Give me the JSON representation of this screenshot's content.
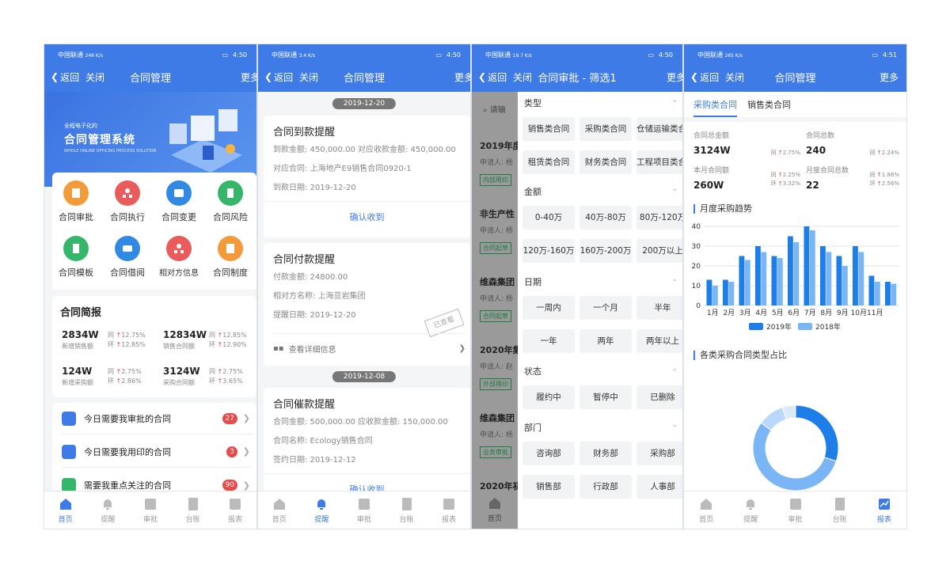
{
  "colors": {
    "primary": "#3f7be6",
    "series2019": "#1e7ee8",
    "series2018": "#7ab6f5",
    "danger": "#e84a4a"
  },
  "status_bars": [
    {
      "carrier": "中国联通",
      "speed": "246 K/s",
      "time": "4:50"
    },
    {
      "carrier": "中国联通",
      "speed": "3.4 K/s",
      "time": "4:50"
    },
    {
      "carrier": "中国联通",
      "speed": "19.7 K/s",
      "time": "4:50"
    },
    {
      "carrier": "中国联通",
      "speed": "265 K/s",
      "time": "4:51"
    }
  ],
  "nav": {
    "back": "返回",
    "close": "关闭",
    "more": "更多"
  },
  "screen1": {
    "title": "合同管理",
    "banner_small": "全程电子化的",
    "banner_title": "合同管理系统",
    "banner_en": "WHOLE ONLINE OFFICING PROCESS SOLUTION",
    "grid": [
      {
        "label": "合同审批",
        "color": "#f39a3a",
        "icon": "approval-icon"
      },
      {
        "label": "合同执行",
        "color": "#ea5b5b",
        "icon": "org-icon"
      },
      {
        "label": "合同变更",
        "color": "#3189e3",
        "icon": "change-icon"
      },
      {
        "label": "合同风险",
        "color": "#36b66a",
        "icon": "risk-icon"
      },
      {
        "label": "合同模板",
        "color": "#36b66a",
        "icon": "template-icon"
      },
      {
        "label": "合同借阅",
        "color": "#3189e3",
        "icon": "borrow-icon"
      },
      {
        "label": "相对方信息",
        "color": "#ea5b5b",
        "icon": "counterparty-icon"
      },
      {
        "label": "合同制度",
        "color": "#f39a3a",
        "icon": "policy-icon"
      }
    ],
    "brief_title": "合同简报",
    "metrics": [
      {
        "value": "2834W",
        "label": "新增销售额",
        "c1": "同",
        "p1": "12.75%",
        "c2": "环",
        "p2": "12.85%"
      },
      {
        "value": "12834W",
        "label": "销售合同额",
        "c1": "同",
        "p1": "12.85%",
        "c2": "环",
        "p2": "12.90%"
      },
      {
        "value": "124W",
        "label": "新增采购额",
        "c1": "同",
        "p1": "2.75%",
        "c2": "环",
        "p2": "2.86%"
      },
      {
        "value": "3124W",
        "label": "采购合同额",
        "c1": "同",
        "p1": "2.75%",
        "c2": "环",
        "p2": "3.65%"
      }
    ],
    "todos": [
      {
        "label": "今日需要我审批的合同",
        "count": "27"
      },
      {
        "label": "今日需要我用印的合同",
        "count": "3"
      },
      {
        "label": "需要我重点关注的合同",
        "count": "90"
      }
    ]
  },
  "tabs": [
    "首页",
    "提醒",
    "审批",
    "台账",
    "报表"
  ],
  "screen2": {
    "title": "合同管理",
    "date1": "2019-12-20",
    "card1": {
      "title": "合同到款提醒",
      "line1": "到款金额: 450,000.00   对应收款金额: 450,000.00",
      "line2": "对应合同: 上海地产E9销售合同0920-1",
      "line3": "到款日期: 2019-12-20",
      "action": "确认收到"
    },
    "card2": {
      "title": "合同付款提醒",
      "line1": "付款金额: 24800.00",
      "line2": "相对方名称: 上海亘岩集团",
      "line3": "提醒日期: 2019-12-20",
      "stamp": "已查看",
      "detail": "查看详细信息"
    },
    "date2": "2019-12-08",
    "card3": {
      "title": "合同催款提醒",
      "line1": "合同金额: 500,000.00   应收款金额: 150,000.00",
      "line2": "合同名称: Ecology销售合同",
      "line3": "签约日期: 2019-12-12",
      "action": "确认收到"
    }
  },
  "screen3": {
    "title": "合同审批 - 筛选1",
    "search_placeholder": "请输",
    "bg_items": [
      {
        "title": "2019年度",
        "sub": "申请人: 杨",
        "tag": "内部用印"
      },
      {
        "title": "非生产性",
        "sub": "申请人: 杨",
        "tag": "合同起草"
      },
      {
        "title": "维森集团",
        "sub": "申请人: 杨",
        "tag": "合同起草"
      },
      {
        "title": "2020年集",
        "sub": "申请人: 赵",
        "tag": "外部用印"
      },
      {
        "title": "维森集团",
        "sub": "申请人: 杨",
        "tag": "业务审批"
      },
      {
        "title": "2020年初",
        "sub": "",
        "tag": ""
      }
    ],
    "groups": [
      {
        "name": "类型",
        "options": [
          "销售类合同",
          "采购类合同",
          "仓储运输类合同",
          "租赁类合同",
          "财务类合同",
          "工程项目类合同"
        ]
      },
      {
        "name": "金额",
        "options": [
          "0-40万",
          "40万-80万",
          "80万-120万",
          "120万-160万",
          "160万-200万",
          "200万以上"
        ]
      },
      {
        "name": "日期",
        "options": [
          "一周内",
          "一个月",
          "半年",
          "一年",
          "两年",
          "两年以上"
        ]
      },
      {
        "name": "状态",
        "options": [
          "履约中",
          "暂停中",
          "已删除"
        ]
      },
      {
        "name": "部门",
        "options": [
          "咨询部",
          "财务部",
          "采购部",
          "销售部",
          "行政部",
          "人事部"
        ]
      }
    ]
  },
  "screen4": {
    "title": "合同管理",
    "tabs": [
      "采购类合同",
      "销售类合同"
    ],
    "kpis": [
      {
        "label": "合同总金额",
        "value": "3124W",
        "c1": "同",
        "p1": "2.75%",
        "c2": "",
        "p2": ""
      },
      {
        "label": "合同总数",
        "value": "240",
        "c1": "同",
        "p1": "2.24%",
        "c2": "",
        "p2": ""
      },
      {
        "label": "本月合同额",
        "value": "260W",
        "c1": "同",
        "p1": "2.25%",
        "c2": "环",
        "p2": "3.32%"
      },
      {
        "label": "月度合同总数",
        "value": "22",
        "c1": "同",
        "p1": "1.86%",
        "c2": "环",
        "p2": "2.56%"
      }
    ],
    "trend_title": "月度采购趋势",
    "pie_title": "各类采购合同类型占比"
  },
  "chart_data": [
    {
      "type": "bar",
      "title": "月度采购趋势",
      "categories": [
        "1月",
        "2月",
        "3月",
        "4月",
        "5月",
        "6月",
        "7月",
        "8月",
        "9月",
        "10月",
        "11月"
      ],
      "series": [
        {
          "name": "2019年",
          "values": [
            13,
            13,
            25,
            30,
            25,
            35,
            40,
            30,
            25,
            30,
            15,
            12
          ]
        },
        {
          "name": "2018年",
          "values": [
            10,
            12,
            23,
            27,
            24,
            32,
            38,
            27,
            20,
            27,
            12,
            11
          ]
        }
      ],
      "ylim": [
        0,
        40
      ],
      "yticks": [
        0,
        10,
        20,
        30,
        40
      ],
      "legend": "bottom",
      "grid": true
    },
    {
      "type": "pie",
      "title": "各类采购合同类型占比",
      "values": [
        30,
        55,
        10,
        5
      ],
      "colors": [
        "#1e7ee8",
        "#7ab6f5",
        "#b9d8fb",
        "#dce9f8"
      ],
      "donut": true
    }
  ]
}
